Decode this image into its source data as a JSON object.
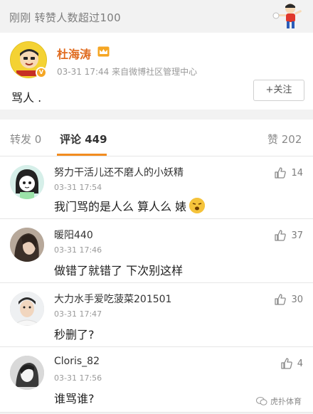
{
  "notice": {
    "text": "刚刚  转赞人数超过100"
  },
  "post": {
    "author": "杜海涛",
    "meta": "03-31 17:44  来自微博社区管理中心",
    "follow_label": "+关注",
    "text": "骂人 ."
  },
  "tabs": {
    "repost": "转发 0",
    "comment": "评论 449",
    "like": "赞 202"
  },
  "comments": [
    {
      "name": "努力干活儿还不磨人的小妖精",
      "time": "03-31 17:54",
      "text": "我门骂的是人么 算人么     婊",
      "likes": "14"
    },
    {
      "name": "暖阳440",
      "time": "03-31 17:46",
      "text": "做错了就错了 下次别这样",
      "likes": "37"
    },
    {
      "name": "大力水手爱吃菠菜201501",
      "time": "03-31 17:47",
      "text": "秒删了?",
      "likes": "30"
    },
    {
      "name": "Cloris_82",
      "time": "03-31 17:56",
      "text": "谁骂谁?",
      "likes": "4"
    }
  ],
  "watermark": "虎扑体育",
  "colors": {
    "accent": "#f28c20",
    "author": "#e06b1f"
  }
}
